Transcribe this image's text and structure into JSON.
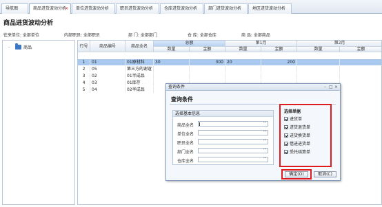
{
  "tabs": [
    {
      "label": "导航图",
      "active": false
    },
    {
      "label": "商品进货波动分析",
      "active": true
    },
    {
      "label": "单位进货波动分析",
      "active": false
    },
    {
      "label": "职员进货波动分析",
      "active": false
    },
    {
      "label": "仓库进货波动分析",
      "active": false
    },
    {
      "label": "部门进货波动分析",
      "active": false
    },
    {
      "label": "地区进货波动分析",
      "active": false
    }
  ],
  "tab_close_glyph": "×",
  "page_title": "商品进货波动分析",
  "filters": {
    "unit": "往来单位:  全部单位",
    "staff": "内部职员:  全部职员",
    "dept": "部  门:  全部部门",
    "warehouse": "仓  库:  全部仓库",
    "goods": "商  品:  全部商品"
  },
  "tree": {
    "expander": "–",
    "root": "商品",
    "icon": "folder-icon"
  },
  "grid": {
    "group_headers": [
      "总额",
      "第1月",
      "第2月"
    ],
    "columns": [
      "行号",
      "商品编号",
      "商品全名",
      "数量",
      "金额",
      "数量",
      "金额",
      "数量",
      "金额"
    ],
    "rows": [
      {
        "no": "1",
        "code": "01",
        "name": "01原材料",
        "q0": "30",
        "a0": "300",
        "q1": "20",
        "a1": "200",
        "q2": "",
        "a2": "",
        "selected": true
      },
      {
        "no": "2",
        "code": "05",
        "name": "第三方的谢谊",
        "q0": "",
        "a0": "",
        "q1": "",
        "a1": "",
        "q2": "",
        "a2": "",
        "selected": false
      },
      {
        "no": "3",
        "code": "02",
        "name": "01半成品",
        "q0": "",
        "a0": "",
        "q1": "",
        "a1": "",
        "q2": "",
        "a2": "",
        "selected": false
      },
      {
        "no": "4",
        "code": "03",
        "name": "01库存",
        "q0": "",
        "a0": "",
        "q1": "",
        "a1": "",
        "q2": "",
        "a2": "",
        "selected": false
      },
      {
        "no": "5",
        "code": "04",
        "name": "02半成品",
        "q0": "",
        "a0": "",
        "q1": "",
        "a1": "",
        "q2": "",
        "a2": "",
        "selected": false
      }
    ]
  },
  "dialog": {
    "title": "查询条件",
    "heading": "查询条件",
    "min_glyph": "–",
    "max_glyph": "□",
    "close_glyph": "×",
    "basic_info_title": "选择基本信息",
    "fields": [
      {
        "label": "商品全名",
        "value": "",
        "browse": "···"
      },
      {
        "label": "单位全名",
        "value": "",
        "browse": "···"
      },
      {
        "label": "职员全名",
        "value": "",
        "browse": "···"
      },
      {
        "label": "部门全名",
        "value": "",
        "browse": "···"
      },
      {
        "label": "仓库全名",
        "value": "",
        "browse": "···"
      }
    ],
    "bill_types_title": "选择单据",
    "bill_types": [
      {
        "label": "进货单",
        "checked": true
      },
      {
        "label": "进货退货单",
        "checked": true
      },
      {
        "label": "进货换货单",
        "checked": true
      },
      {
        "label": "借进进货单",
        "checked": true
      },
      {
        "label": "受托结算单",
        "checked": true
      }
    ],
    "ok_label": "确定(O)",
    "cancel_label": "取消(C)"
  }
}
